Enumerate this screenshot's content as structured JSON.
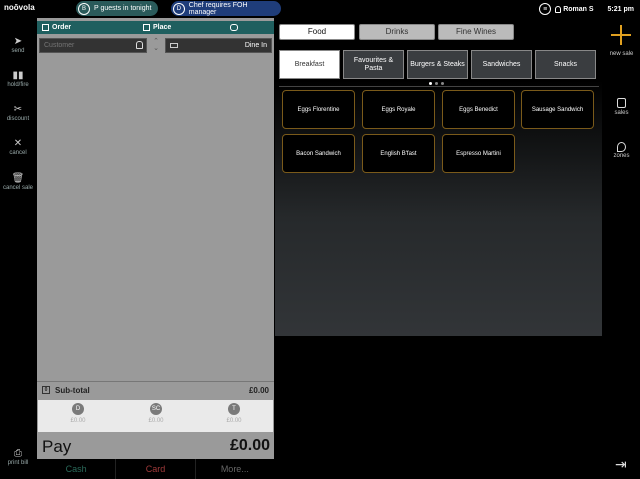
{
  "topbar": {
    "brand": "noōvola",
    "notifications": [
      {
        "icon": "B",
        "text": "P guests in tonight"
      },
      {
        "icon": "D",
        "text": "Chef requires FOH manager"
      }
    ],
    "user": "Roman S",
    "time": "5:21 pm"
  },
  "left_sidebar": [
    {
      "label": "send",
      "icon": "send-icon",
      "glyph": "➤"
    },
    {
      "label": "hold/fire",
      "icon": "hold-fire-icon",
      "glyph": "▮▮"
    },
    {
      "label": "discount",
      "icon": "scissors-icon",
      "glyph": "✂"
    },
    {
      "label": "cancel",
      "icon": "cancel-icon",
      "glyph": "✕"
    },
    {
      "label": "cancel sale",
      "icon": "trash-icon",
      "glyph": "🗑"
    },
    {
      "label": "print bill",
      "icon": "printer-icon",
      "glyph": "⎙"
    }
  ],
  "order": {
    "tabs": {
      "order": "Order",
      "place": "Place"
    },
    "customer_placeholder": "Customer",
    "dine_mode": "Dine In",
    "subtotal_label": "Sub-total",
    "subtotal_icon": "0",
    "subtotal_value": "£0.00",
    "charges": [
      {
        "badge": "D",
        "value": "£0.00"
      },
      {
        "badge": "SC",
        "value": "£0.00"
      },
      {
        "badge": "T",
        "value": "£0.00"
      }
    ],
    "pay_label": "Pay",
    "pay_value": "£0.00"
  },
  "payment_tabs": [
    "Cash",
    "Card",
    "More..."
  ],
  "menu": {
    "categories": [
      {
        "label": "Food",
        "active": true
      },
      {
        "label": "Drinks",
        "active": false
      },
      {
        "label": "Fine Wines",
        "active": false
      }
    ],
    "subcategories": [
      {
        "label": "Breakfast",
        "active": true
      },
      {
        "label": "Favourites & Pasta",
        "active": false
      },
      {
        "label": "Burgers & Steaks",
        "active": false
      },
      {
        "label": "Sandwiches",
        "active": false
      },
      {
        "label": "Snacks",
        "active": false
      }
    ],
    "items": [
      "Eggs Florentine",
      "Eggs Royale",
      "Eggs Benedict",
      "Sausage Sandwich",
      "Bacon Sandwich",
      "English B'fast",
      "Espresso Martini"
    ]
  },
  "right_sidebar": {
    "new_sale": "new sale",
    "sales": "sales",
    "zones": "zones"
  },
  "colors": {
    "accent": "#e0a020",
    "order_header": "#1f5f5f",
    "item_border": "#7a5a1a"
  }
}
